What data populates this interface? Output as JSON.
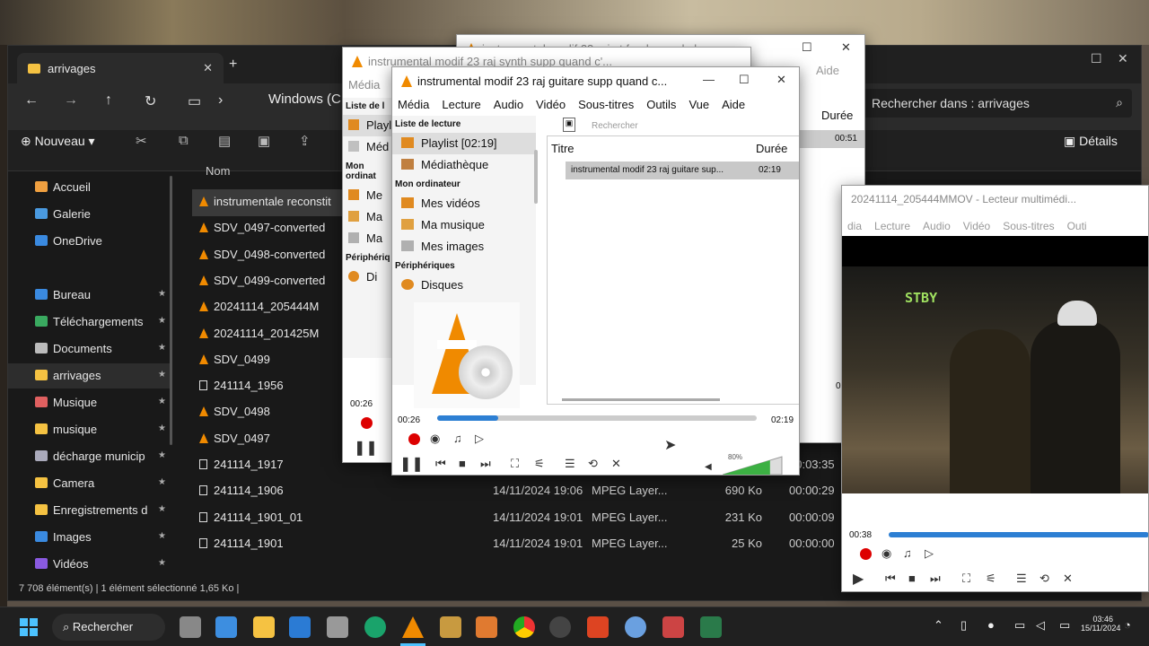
{
  "explorer": {
    "tab_title": "arrivages",
    "crumb": "Windows (C",
    "search_placeholder": "Rechercher dans : arrivages",
    "new_label": "Nouveau",
    "details_label": "Détails",
    "col_name": "Nom",
    "status": "7 708 élément(s)  |  1 élément sélectionné  1,65 Ko  |",
    "sidebar": [
      {
        "label": "Accueil",
        "pin": ""
      },
      {
        "label": "Galerie",
        "pin": ""
      },
      {
        "label": "OneDrive",
        "pin": ""
      },
      {
        "label": "Bureau",
        "pin": "★"
      },
      {
        "label": "Téléchargements",
        "pin": "★"
      },
      {
        "label": "Documents",
        "pin": "★"
      },
      {
        "label": "arrivages",
        "pin": "★"
      },
      {
        "label": "Musique",
        "pin": "★"
      },
      {
        "label": "musique",
        "pin": "★"
      },
      {
        "label": "décharge municip",
        "pin": "★"
      },
      {
        "label": "Camera",
        "pin": "★"
      },
      {
        "label": "Enregistrements d",
        "pin": "★"
      },
      {
        "label": "Images",
        "pin": "★"
      },
      {
        "label": "Vidéos",
        "pin": "★"
      }
    ],
    "files": [
      {
        "name": "instrumentale reconstit",
        "date": "",
        "type": "",
        "size": "",
        "len": ""
      },
      {
        "name": "SDV_0497-converted",
        "date": "",
        "type": "",
        "size": "",
        "len": ""
      },
      {
        "name": "SDV_0498-converted",
        "date": "",
        "type": "",
        "size": "",
        "len": ""
      },
      {
        "name": "SDV_0499-converted",
        "date": "",
        "type": "",
        "size": "",
        "len": ""
      },
      {
        "name": "20241114_205444M",
        "date": "",
        "type": "",
        "size": "",
        "len": ""
      },
      {
        "name": "20241114_201425M",
        "date": "",
        "type": "",
        "size": "",
        "len": ""
      },
      {
        "name": "SDV_0499",
        "date": "",
        "type": "",
        "size": "",
        "len": ""
      },
      {
        "name": "241114_1956",
        "date": "",
        "type": "",
        "size": "",
        "len": ""
      },
      {
        "name": "SDV_0498",
        "date": "",
        "type": "",
        "size": "",
        "len": ""
      },
      {
        "name": "SDV_0497",
        "date": "",
        "type": "",
        "size": "",
        "len": ""
      },
      {
        "name": "241114_1917",
        "date": "",
        "type": "",
        "size": "",
        "len": "00:03:35"
      },
      {
        "name": "241114_1906",
        "date": "14/11/2024 19:06",
        "type": "MPEG Layer...",
        "size": "690 Ko",
        "len": "00:00:29"
      },
      {
        "name": "241114_1901_01",
        "date": "14/11/2024 19:01",
        "type": "MPEG Layer...",
        "size": "231 Ko",
        "len": "00:00:09"
      },
      {
        "name": "241114_1901",
        "date": "14/11/2024 19:01",
        "type": "MPEG Layer...",
        "size": "25 Ko",
        "len": "00:00:00"
      }
    ]
  },
  "vlc_back": {
    "title": "instrumental modif 23 raj synth supp quand c'...",
    "menu": [
      "Média"
    ],
    "pl_header": "Liste de l",
    "items": [
      "Playl",
      "Méd"
    ],
    "section": "Mon ordinat",
    "sub": [
      "Me",
      "Ma",
      "Ma"
    ],
    "periph": "Périphériq",
    "disc": "Di",
    "time": "00:26"
  },
  "vlc_far": {
    "title": "instrumental modif 23 raj et fond quand ela",
    "aide": "Aide",
    "duree": "Durée",
    "dur_value": "00:51",
    "time_right": "03:51"
  },
  "vlc_front": {
    "title": "instrumental modif 23 raj guitare supp quand c...",
    "menu": [
      "Média",
      "Lecture",
      "Audio",
      "Vidéo",
      "Sous-titres",
      "Outils",
      "Vue",
      "Aide"
    ],
    "pl_header": "Liste de lecture",
    "search_placeholder": "Rechercher",
    "playlist": "Playlist [02:19]",
    "mediatheque": "Médiathèque",
    "mon_ordi": "Mon ordinateur",
    "items": [
      "Mes vidéos",
      "Ma musique",
      "Mes images"
    ],
    "periph": "Périphériques",
    "disques": "Disques",
    "col_title": "Titre",
    "col_duree": "Durée",
    "track_name": "instrumental modif 23 raj guitare sup...",
    "track_dur": "02:19",
    "elapsed": "00:26",
    "total": "02:19",
    "volume": "80%",
    "progress": 0.19
  },
  "vlc_video": {
    "title": "20241114_205444MMOV - Lecteur multimédi...",
    "menu": [
      "dia",
      "Lecture",
      "Audio",
      "Vidéo",
      "Sous-titres",
      "Outi"
    ],
    "overlay": "STBY",
    "elapsed": "00:38"
  },
  "taskbar": {
    "search": "Rechercher",
    "time": "03:46",
    "date": "15/11/2024"
  }
}
